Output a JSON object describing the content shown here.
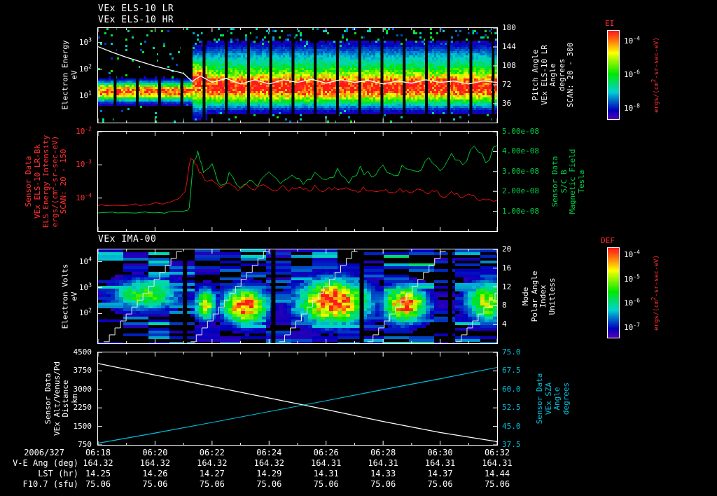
{
  "titles": {
    "els_lr": "VEx ELS-10 LR",
    "els_hr": "VEx ELS-10 HR",
    "ima": "VEx IMA-00"
  },
  "colors": {
    "red": "#ff3030",
    "green": "#00cc44",
    "cyan": "#00bfdf",
    "white": "#ffffff",
    "background": "#000000"
  },
  "time_axis": {
    "date_label": "2006/327",
    "labels": [
      "06:18",
      "06:20",
      "06:22",
      "06:24",
      "06:26",
      "06:28",
      "06:30",
      "06:32"
    ],
    "duration_min": 14
  },
  "footer": {
    "rows": [
      {
        "label": "V-E Ang (deg)",
        "values": [
          "164.32",
          "164.32",
          "164.32",
          "164.32",
          "164.31",
          "164.31",
          "164.31",
          "164.31"
        ]
      },
      {
        "label": "LST (hr)",
        "values": [
          "14.25",
          "14.26",
          "14.27",
          "14.29",
          "14.31",
          "14.33",
          "14.37",
          "14.44"
        ]
      },
      {
        "label": "F10.7 (sfu)",
        "values": [
          "75.06",
          "75.06",
          "75.06",
          "75.06",
          "75.06",
          "75.06",
          "75.06",
          "75.06"
        ]
      }
    ]
  },
  "panels": {
    "p1": {
      "left_label_lines": [
        "Electron Energy",
        "eV"
      ],
      "left_ticks": [
        {
          "t": "10^3",
          "f": 0.154
        },
        {
          "t": "10^2",
          "f": 0.436
        },
        {
          "t": "10^1",
          "f": 0.718
        }
      ],
      "right_label_lines": [
        "Pitch Angle",
        "VEx ELS-10 LR",
        "Angle",
        "degrees",
        "SCAN: 20 - 300"
      ],
      "right_ticks": [
        {
          "t": "180",
          "f": 0.0
        },
        {
          "t": "144",
          "f": 0.2
        },
        {
          "t": "108",
          "f": 0.4
        },
        {
          "t": "72",
          "f": 0.6
        },
        {
          "t": "36",
          "f": 0.8
        }
      ],
      "colorbar": {
        "title": "EI",
        "units": "ergs/(cm^2-sr-sec-eV)",
        "ticks": [
          {
            "t": "10^-4",
            "f": 0.12
          },
          {
            "t": "10^-6",
            "f": 0.5
          },
          {
            "t": "10^-8",
            "f": 0.88
          }
        ]
      }
    },
    "p2": {
      "left_label_lines": [
        "Sensor Data",
        "VEx ELS-10 LR-Bk",
        "ELS Energy Intensity",
        "ergs/(cm^2-sr-sec-eV)",
        "SCAN: 20 - 150"
      ],
      "left_ticks": [
        {
          "t": "10^-2",
          "f": 0.0
        },
        {
          "t": "10^-3",
          "f": 0.333
        },
        {
          "t": "10^-4",
          "f": 0.667
        }
      ],
      "right_label_lines": [
        "Sensor Data",
        "S/C B",
        "Magnetic Field",
        "Tesla"
      ],
      "right_ticks": [
        {
          "t": "5.00e-08",
          "f": 0.0
        },
        {
          "t": "4.00e-08",
          "f": 0.2
        },
        {
          "t": "3.00e-08",
          "f": 0.4
        },
        {
          "t": "2.00e-08",
          "f": 0.6
        },
        {
          "t": "1.00e-08",
          "f": 0.8
        }
      ]
    },
    "p3": {
      "left_label_lines": [
        "Electron Volts",
        "eV"
      ],
      "left_ticks": [
        {
          "t": "10^4",
          "f": 0.131
        },
        {
          "t": "10^3",
          "f": 0.407
        },
        {
          "t": "10^2",
          "f": 0.682
        }
      ],
      "right_label_lines": [
        "Mode",
        "Polar Angle",
        "Index",
        "Unitless"
      ],
      "right_ticks": [
        {
          "t": "20",
          "f": 0.0
        },
        {
          "t": "16",
          "f": 0.2
        },
        {
          "t": "12",
          "f": 0.4
        },
        {
          "t": "8",
          "f": 0.6
        },
        {
          "t": "4",
          "f": 0.8
        }
      ],
      "colorbar": {
        "title": "DEF",
        "units": "ergs/(cm^2-sr-sec-eV)",
        "ticks": [
          {
            "t": "10^-4",
            "f": 0.08
          },
          {
            "t": "10^-5",
            "f": 0.35
          },
          {
            "t": "10^-6",
            "f": 0.62
          },
          {
            "t": "10^-7",
            "f": 0.89
          }
        ]
      }
    },
    "p4": {
      "left_label_lines": [
        "Sensor Data",
        "VEx Alt/Venus/Pd",
        "Distance",
        "km"
      ],
      "left_ticks": [
        {
          "t": "4500",
          "f": 0.0
        },
        {
          "t": "3750",
          "f": 0.2
        },
        {
          "t": "3000",
          "f": 0.4
        },
        {
          "t": "2250",
          "f": 0.6
        },
        {
          "t": "1500",
          "f": 0.8
        },
        {
          "t": "750",
          "f": 1.0
        }
      ],
      "right_label_lines": [
        "Sensor Data",
        "VEx SZA",
        "Angle",
        "degrees"
      ],
      "right_ticks": [
        {
          "t": "75.0",
          "f": 0.0
        },
        {
          "t": "67.5",
          "f": 0.2
        },
        {
          "t": "60.0",
          "f": 0.4
        },
        {
          "t": "52.5",
          "f": 0.6
        },
        {
          "t": "45.0",
          "f": 0.8
        },
        {
          "t": "37.5",
          "f": 1.0
        }
      ]
    }
  },
  "chart_data": [
    {
      "type": "heatmap",
      "panel": "p1",
      "title": "VEx ELS-10 LR/HR electron energy-time spectrogram",
      "x": {
        "unit": "UT",
        "start": "06:18",
        "end": "06:32",
        "duration_min": 14
      },
      "y": {
        "label": "Electron Energy (eV)",
        "scale": "log",
        "range": [
          1,
          3500
        ]
      },
      "z": {
        "label": "EI ergs/(cm^2-sr-sec-eV)",
        "scale": "log",
        "range": [
          1e-08,
          0.0001
        ]
      },
      "features": {
        "shock_time_min": 3.3,
        "preshock_band": {
          "center_eV": 16,
          "log_sigma": 0.22,
          "speckle_density": 0.045
        },
        "shock_layer": {
          "center_eV": 35,
          "log_sigma": 0.6,
          "t_range_min": [
            3.25,
            3.8
          ]
        },
        "postshock_band": {
          "center_eV": 22,
          "log_sigma": 0.42,
          "halo_center_eV": 200,
          "halo_amp": 0.3,
          "speckle_density": 0.11
        },
        "data_gap_period_min": 0.78
      },
      "overlay_line": {
        "color": "#ffffff",
        "points": [
          [
            0,
            700
          ],
          [
            0.5,
            430
          ],
          [
            1,
            280
          ],
          [
            1.5,
            190
          ],
          [
            2,
            130
          ],
          [
            2.5,
            95
          ],
          [
            3,
            70
          ],
          [
            3.3,
            35
          ],
          [
            3.6,
            56
          ],
          [
            4,
            32
          ],
          [
            4.5,
            45
          ],
          [
            5,
            28
          ],
          [
            5.5,
            40
          ],
          [
            6,
            28
          ],
          [
            6.5,
            40
          ],
          [
            7,
            32
          ],
          [
            7.5,
            42
          ],
          [
            8,
            30
          ],
          [
            8.5,
            40
          ],
          [
            9,
            32
          ],
          [
            9.5,
            38
          ],
          [
            10,
            28
          ],
          [
            10.5,
            36
          ],
          [
            11,
            30
          ],
          [
            11.5,
            40
          ],
          [
            12,
            32
          ],
          [
            12.5,
            36
          ],
          [
            13,
            28
          ],
          [
            13.5,
            36
          ],
          [
            14,
            32
          ]
        ]
      }
    },
    {
      "type": "line",
      "panel": "p2",
      "x": {
        "unit": "minutes since 06:18",
        "range": [
          0,
          14
        ]
      },
      "series": [
        {
          "name": "ELS Energy Intensity",
          "units": "ergs/(cm^2-sr-sec-eV)",
          "color": "#ee1111",
          "axis": "left",
          "scale": "log",
          "axis_range": [
            1e-05,
            0.01
          ],
          "points": [
            [
              0,
              6e-05
            ],
            [
              0.4,
              6.2e-05
            ],
            [
              0.8,
              5.8e-05
            ],
            [
              1.2,
              6.5e-05
            ],
            [
              1.6,
              6e-05
            ],
            [
              2.0,
              7e-05
            ],
            [
              2.3,
              6.5e-05
            ],
            [
              2.6,
              8e-05
            ],
            [
              2.85,
              0.0001
            ],
            [
              3.05,
              0.00015
            ],
            [
              3.25,
              0.0017
            ],
            [
              3.4,
              0.0012
            ],
            [
              3.55,
              0.0006
            ],
            [
              3.75,
              0.00035
            ],
            [
              4.0,
              0.0003
            ],
            [
              4.3,
              0.00022
            ],
            [
              4.6,
              0.00026
            ],
            [
              4.9,
              0.00019
            ],
            [
              5.2,
              0.00024
            ],
            [
              5.5,
              0.00018
            ],
            [
              5.8,
              0.00023
            ],
            [
              6.1,
              0.00017
            ],
            [
              6.4,
              0.00022
            ],
            [
              6.7,
              0.00018
            ],
            [
              7.0,
              0.00023
            ],
            [
              7.3,
              0.00017
            ],
            [
              7.6,
              0.00021
            ],
            [
              7.9,
              0.00016
            ],
            [
              8.2,
              0.0002
            ],
            [
              8.5,
              0.00016
            ],
            [
              8.8,
              0.00021
            ],
            [
              9.1,
              0.00017
            ],
            [
              9.4,
              0.0002
            ],
            [
              9.7,
              0.00015
            ],
            [
              10.0,
              0.00019
            ],
            [
              10.3,
              0.00015
            ],
            [
              10.6,
              0.00018
            ],
            [
              10.9,
              0.00014
            ],
            [
              11.2,
              0.00017
            ],
            [
              11.5,
              0.00013
            ],
            [
              11.8,
              0.00016
            ],
            [
              12.1,
              0.00012
            ],
            [
              12.4,
              0.00014
            ],
            [
              12.7,
              0.00011
            ],
            [
              13.0,
              0.00012
            ],
            [
              13.3,
              0.0001
            ],
            [
              13.6,
              9e-05
            ],
            [
              14,
              8.5e-05
            ]
          ]
        },
        {
          "name": "S/C B Magnetic Field",
          "units": "Tesla",
          "color": "#00cc33",
          "axis": "right",
          "scale": "linear",
          "axis_range": [
            0,
            5e-08
          ],
          "points": [
            [
              0,
              9e-09
            ],
            [
              0.5,
              9.5e-09
            ],
            [
              1,
              9e-09
            ],
            [
              1.5,
              9.5e-09
            ],
            [
              2,
              9e-09
            ],
            [
              2.5,
              9.5e-09
            ],
            [
              3,
              1e-08
            ],
            [
              3.2,
              1.1e-08
            ],
            [
              3.35,
              3.6e-08
            ],
            [
              3.5,
              4e-08
            ],
            [
              3.7,
              2.8e-08
            ],
            [
              4,
              3.2e-08
            ],
            [
              4.3,
              2.2e-08
            ],
            [
              4.6,
              2.8e-08
            ],
            [
              5,
              2e-08
            ],
            [
              5.3,
              2.6e-08
            ],
            [
              5.6,
              2.2e-08
            ],
            [
              6,
              3e-08
            ],
            [
              6.4,
              2.4e-08
            ],
            [
              6.8,
              2.9e-08
            ],
            [
              7.2,
              2.3e-08
            ],
            [
              7.6,
              2.8e-08
            ],
            [
              8,
              2.5e-08
            ],
            [
              8.4,
              3e-08
            ],
            [
              8.8,
              2.6e-08
            ],
            [
              9.2,
              3.1e-08
            ],
            [
              9.6,
              2.7e-08
            ],
            [
              10,
              3.2e-08
            ],
            [
              10.4,
              2.8e-08
            ],
            [
              10.8,
              3.3e-08
            ],
            [
              11.2,
              3e-08
            ],
            [
              11.6,
              3.6e-08
            ],
            [
              12,
              3.1e-08
            ],
            [
              12.4,
              3.8e-08
            ],
            [
              12.8,
              3.3e-08
            ],
            [
              13.2,
              4.2e-08
            ],
            [
              13.6,
              3.5e-08
            ],
            [
              14,
              4.3e-08
            ]
          ]
        }
      ]
    },
    {
      "type": "heatmap",
      "panel": "p3",
      "title": "VEx IMA-00 energy-time spectrogram",
      "y": {
        "label": "Electron Volts (eV)",
        "scale": "log",
        "range": [
          7,
          30000
        ]
      },
      "z": {
        "label": "DEF ergs/(cm^2-sr-sec-eV)",
        "scale": "log",
        "range": [
          1e-07,
          0.0001
        ]
      },
      "features": {
        "cycle_gaps_min": [
          3.05,
          6.15,
          9.25,
          12.35
        ],
        "sweep_cycles_start_min": [
          0.2,
          3.25,
          6.35,
          9.45,
          12.55
        ],
        "sweep_duration_min": 2.75,
        "sweep_energy_range_eV": [
          8,
          25000
        ],
        "blobs": [
          {
            "t_min": 1.6,
            "energy_eV": 600,
            "sigma_t": 0.8,
            "sigma_logE": 0.4,
            "intensity": 0.55
          },
          {
            "t_min": 3.7,
            "energy_eV": 250,
            "sigma_t": 0.25,
            "sigma_logE": 0.4,
            "intensity": 0.7
          },
          {
            "t_min": 5.1,
            "energy_eV": 220,
            "sigma_t": 0.5,
            "sigma_logE": 0.45,
            "intensity": 1.0
          },
          {
            "t_min": 8.2,
            "energy_eV": 320,
            "sigma_t": 0.8,
            "sigma_logE": 0.55,
            "intensity": 1.05
          },
          {
            "t_min": 10.7,
            "energy_eV": 250,
            "sigma_t": 0.5,
            "sigma_logE": 0.45,
            "intensity": 0.95
          },
          {
            "t_min": 13.6,
            "energy_eV": 320,
            "sigma_t": 0.5,
            "sigma_logE": 0.5,
            "intensity": 0.72
          }
        ]
      }
    },
    {
      "type": "line",
      "panel": "p4",
      "series": [
        {
          "name": "VEx Alt/Venus/Pd Distance",
          "units": "km",
          "color": "#ffffff",
          "axis": "left",
          "axis_range": [
            750,
            4500
          ],
          "points": [
            [
              0,
              4050
            ],
            [
              2,
              3580
            ],
            [
              4,
              3120
            ],
            [
              6,
              2650
            ],
            [
              8,
              2180
            ],
            [
              10,
              1700
            ],
            [
              12,
              1250
            ],
            [
              14,
              880
            ]
          ]
        },
        {
          "name": "VEx SZA Angle",
          "units": "degrees",
          "color": "#00bfdf",
          "axis": "right",
          "axis_range": [
            37.5,
            75.0
          ],
          "points": [
            [
              0,
              38.2
            ],
            [
              2,
              42.3
            ],
            [
              4,
              46.6
            ],
            [
              6,
              51.0
            ],
            [
              8,
              55.4
            ],
            [
              10,
              59.9
            ],
            [
              12,
              64.3
            ],
            [
              14,
              68.9
            ]
          ]
        }
      ]
    }
  ]
}
